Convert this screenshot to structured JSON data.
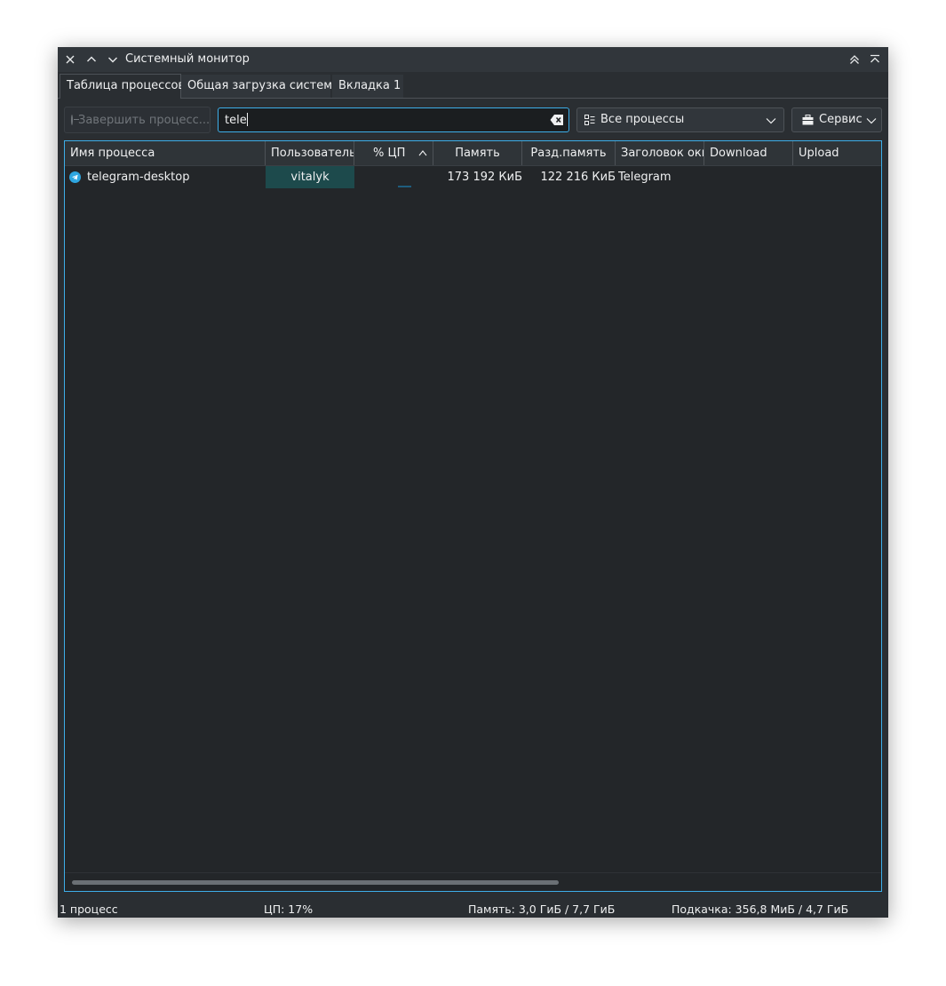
{
  "window": {
    "title": "Системный монитор"
  },
  "tabs": [
    {
      "label": "Таблица процессов"
    },
    {
      "label": "Общая загрузка системы"
    },
    {
      "label": "Вкладка 1"
    }
  ],
  "toolbar": {
    "terminate_label": "Завершить процесс...",
    "search_value": "tele",
    "filter_label": "Все процессы",
    "tools_label": "Сервис"
  },
  "table": {
    "columns": [
      "Имя процесса",
      "Пользователь",
      "% ЦП",
      "Память",
      "Разд.память",
      "Заголовок окна",
      "Download",
      "Upload"
    ],
    "sort_column": "% ЦП",
    "rows": [
      {
        "name": "telegram-desktop",
        "user": "vitalyk",
        "cpu": "",
        "memory": "173 192 КиБ",
        "shared": "122 216 КиБ",
        "window_title": "Telegram",
        "download": "",
        "upload": ""
      }
    ]
  },
  "status": {
    "processes": "1 процесс",
    "cpu": "ЦП: 17%",
    "memory": "Память: 3,0 ГиБ / 7,7 ГиБ",
    "swap": "Подкачка: 356,8 МиБ / 4,7 ГиБ"
  },
  "colors": {
    "accent": "#3daee9",
    "window_bg": "#2a2e32",
    "table_bg": "#232629",
    "selected_user_bg": "#1d4a4c"
  }
}
